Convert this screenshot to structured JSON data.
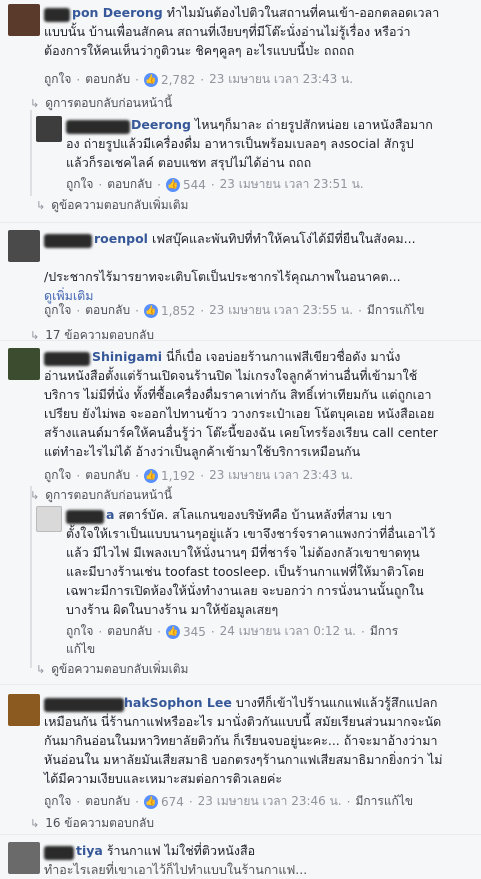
{
  "comments": [
    {
      "name": "pon Deerong",
      "text": [
        "ทำไมมันต้องไปติวในสถานที่คนเข้า-ออกตลอดเวลา",
        "แบบนั้น บ้านเพื่อนสักคน สถานที่เงียบๆที่มีโต๊ะนั่งอ่านไม่รู้เรื่อง หรือว่า",
        "ต้องการให้คนเห็นว่ากูติวนะ ชิคๆคูลๆ อะไรแบบนี้ป่ะ ถถถถ"
      ],
      "like": "ถูกใจ",
      "reply": "ตอบกลับ",
      "count": "2,782",
      "time": "23 เมษายน เวลา 23:43 น.",
      "thread_link": "ดูการตอบกลับก่อนหน้านี้"
    },
    {
      "name": "Deerong",
      "text": [
        "ไหนๆก็มาละ ถ่ายรูปสักหน่อย เอาหนังสือมาก",
        "อง ถ่ายรูปแล้วมีเครื่องดื่ม อาหารเป็นพร้อมเบลอๆ ลงsocial สักรูป",
        "แล้วก็รอเชคไลค์ ตอบแชท สรุปไม่ได้อ่าน ถถถ"
      ],
      "like": "ถูกใจ",
      "reply": "ตอบกลับ",
      "count": "544",
      "time": "23 เมษายน เวลา 23:51 น.",
      "thread_link": "ดูข้อความตอบกลับเพิ่มเติม"
    },
    {
      "name": "roenpol",
      "text": [
        "เฟสบุ๊คและพันทิปที่ทำให้คนโง่ได้มีที่ยืนในสังคม...",
        "",
        "/ประชากรไร้มารยาทจะเติบโตเป็นประชากรไร้คุณภาพในอนาคต..."
      ],
      "see_more": "ดูเพิ่มเติม",
      "like": "ถูกใจ",
      "reply": "ตอบกลับ",
      "count": "1,852",
      "time": "23 เมษายน เวลา 23:55 น.",
      "edited": "มีการแก้ไข",
      "thread_link": "17 ข้อความตอบกลับ"
    },
    {
      "name": "Shinigami",
      "text": [
        "นี่ก็เบื่อ เจอบ่อยร้านกาแฟสีเขียวชื่อดัง มานั่ง",
        "อ่านหนังสือตั้งแต่ร้านเปิดจนร้านปิด ไม่เกรงใจลูกค้าท่านอื่นที่เข้ามาใช้",
        "บริการ ไม่มีที่นั่ง ทั้งที่ซื้อเครื่องดื่มราคาเท่ากัน สิทธิ์เท่าเทียมกัน แต่ถูกเอา",
        "เปรียบ ยังไม่พอ จะออกไปทานข้าว วางกระเป๋าเอย โน้ตบุคเอย หนังสือเอย",
        "สร้างแลนด์มาร์คให้คนอื่นรู้ว่า โต๊ะนี้ของฉัน เคยโทรร้องเรียน call center",
        "แต่ทำอะไรไม่ได้ อ้างว่าเป็นลูกค้าเข้ามาใช้บริการเหมือนกัน"
      ],
      "like": "ถูกใจ",
      "reply": "ตอบกลับ",
      "count": "1,192",
      "time": "23 เมษายน เวลา 23:43 น.",
      "thread_link": "ดูการตอบกลับก่อนหน้านี้"
    },
    {
      "name": "a",
      "text": [
        "สตาร์บัค. สโลแกนของบริษัทคือ บ้านหลังที่สาม เขา",
        "ตั้งใจให้เราเป็นแบบนานๆอยู่แล้ว เขาจึงชาร์จราคาแพงกว่าที่อื่นเอาไว้",
        "แล้ว มีไวไฟ มีเพลงเบาให้นั่งนานๆ มีที่ชาร์จ ไม่ต้องกลัวเขาขาดทุน",
        "และมีบางร้านเช่น toofast toosleep. เป็นร้านกาแฟที่ให้มาติวโดย",
        "เฉพาะมีการเปิดห้องให้นั่งทำงานเลย จะบอกว่า การนั่งนานนั้นถูกใน",
        "บางร้าน ผิดในบางร้าน มาให้ข้อมูลเสยๆ"
      ],
      "like": "ถูกใจ",
      "reply": "ตอบกลับ",
      "count": "345",
      "time": "24 เมษายน เวลา 0:12 น.",
      "edited": "มีการ",
      "edited2": "แก้ไข",
      "thread_link": "ดูข้อความตอบกลับเพิ่มเติม"
    },
    {
      "name": "hakSophon Lee",
      "text": [
        "บางทีก็เข้าไปร้านแกแฟแล้วรู้สึกแปลก",
        "เหมือนกัน นี่ร้านกาแฟหรืออะไร มานั่งติวกันแบบนี้ สมัยเรียนส่วนมากจะนัด",
        "กันมากินอ่อนในมหาวิทยาลัยติวกัน ก็เรียนจบอยู่นะคะ... ถ้าจะมาอ้างว่ามา",
        "หันอ่อนใน มหาลัยมันเสียสมาธิ บอกตรงๆร้านกาแฟเสียสมาธิมากยิ่งกว่า ไม่",
        "ได้มีความเงียบและเหมาะสมต่อการติวเลยค่ะ"
      ],
      "like": "ถูกใจ",
      "reply": "ตอบกลับ",
      "count": "674",
      "time": "23 เมษายน เวลา 23:46 น.",
      "edited": "มีการแก้ไข",
      "thread_link": "16 ข้อความตอบกลับ"
    },
    {
      "name": "tiya",
      "text": [
        "ร้านกาแฟ ไม่ใช่ที่ติวหนังสือ"
      ],
      "partial": "ทำอะไรเลยที่เขาเอาไว้ก็ไปทำแบบในร้านกาแฟ..."
    }
  ],
  "colors": {
    "link": "#365899",
    "meta": "#90949c",
    "like_icon": "#5890ff"
  }
}
